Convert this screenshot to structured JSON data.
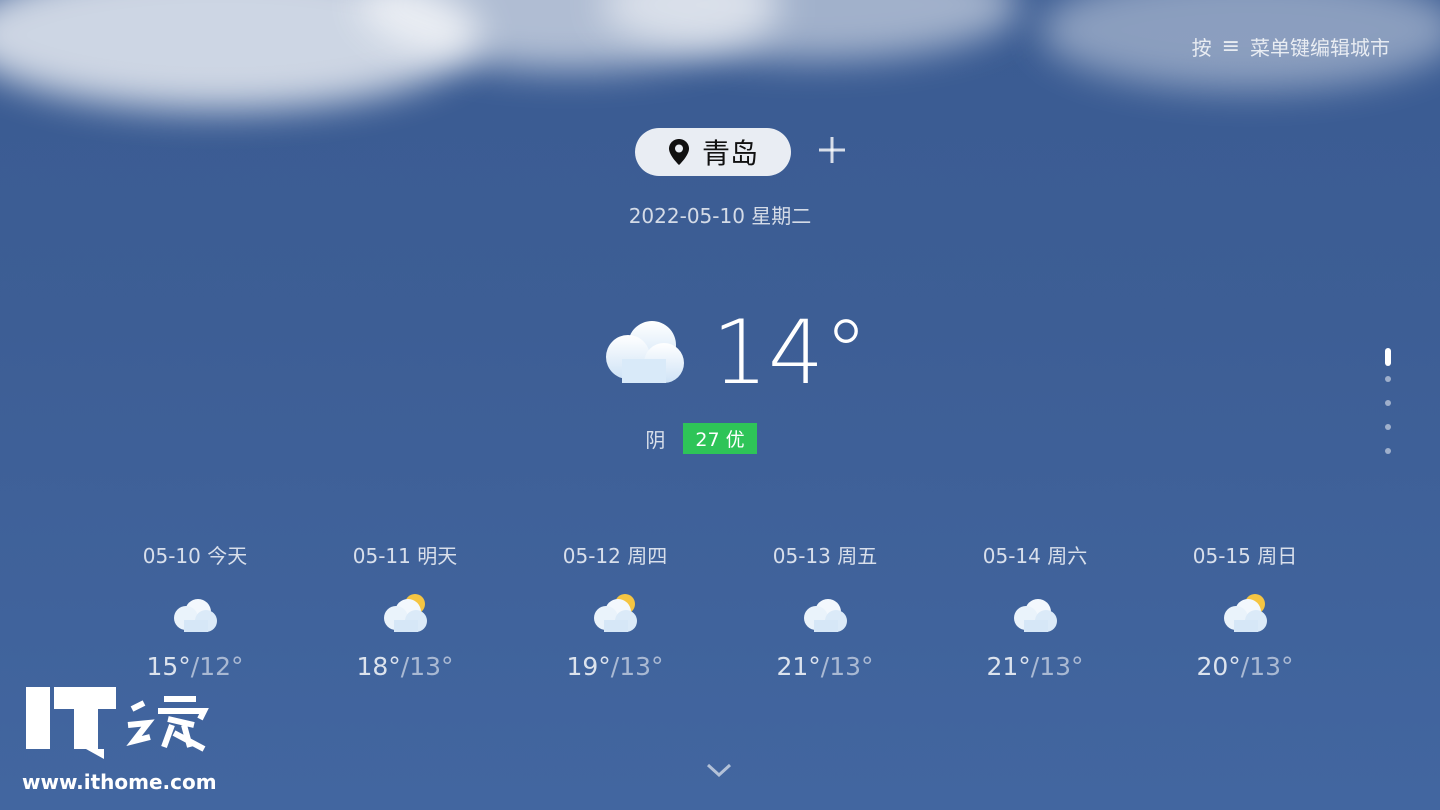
{
  "header": {
    "hint_prefix": "按",
    "hint_icon": "menu-icon",
    "hint_suffix": "菜单键编辑城市"
  },
  "city": {
    "name": "青岛",
    "icon": "location-pin-icon"
  },
  "add_icon": "plus-icon",
  "date": "2022-05-10  星期二",
  "current": {
    "temp": "14°",
    "condition": "阴",
    "aqi": "27 优",
    "icon": "cloudy-icon"
  },
  "aqi_color": "#2ec458",
  "forecast": [
    {
      "label": "05-10 今天",
      "high": "15°",
      "low": "/12°",
      "icon": "cloudy-icon"
    },
    {
      "label": "05-11 明天",
      "high": "18°",
      "low": "/13°",
      "icon": "partly-cloudy-icon"
    },
    {
      "label": "05-12 周四",
      "high": "19°",
      "low": "/13°",
      "icon": "partly-cloudy-icon"
    },
    {
      "label": "05-13 周五",
      "high": "21°",
      "low": "/13°",
      "icon": "cloudy-icon"
    },
    {
      "label": "05-14 周六",
      "high": "21°",
      "low": "/13°",
      "icon": "cloudy-icon"
    },
    {
      "label": "05-15 周日",
      "high": "20°",
      "low": "/13°",
      "icon": "partly-cloudy-icon"
    }
  ],
  "pager": {
    "current": 1,
    "total": 5
  },
  "watermark": {
    "logo": "IT之家",
    "url": "www.ithome.com"
  }
}
